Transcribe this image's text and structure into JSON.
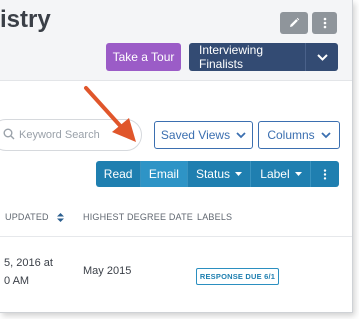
{
  "header": {
    "title": "istry",
    "tour_button": "Take a Tour",
    "stage_button": "Interviewing Finalists"
  },
  "toolbar": {
    "search_placeholder": "Keyword Search",
    "saved_views": "Saved Views",
    "columns": "Columns"
  },
  "actions": {
    "read": "Read",
    "email": "Email",
    "status": "Status",
    "label": "Label"
  },
  "table": {
    "columns": [
      "UPDATED",
      "HIGHEST DEGREE DATE",
      "LABELS"
    ],
    "rows": [
      {
        "updated_line1": "5, 2016 at",
        "updated_line2": "0 AM",
        "highest_degree_date": "May 2015",
        "label": "RESPONSE DUE 6/1"
      }
    ]
  },
  "colors": {
    "tour_purple": "#9b5cc7",
    "stage_navy": "#334b73",
    "action_blue": "#1f7fb0",
    "annotation_arrow": "#e0562b"
  },
  "icons": [
    "pencil-icon",
    "more-vertical-icon",
    "chevron-down-icon",
    "search-icon",
    "sort-icon",
    "annotation-arrow"
  ]
}
